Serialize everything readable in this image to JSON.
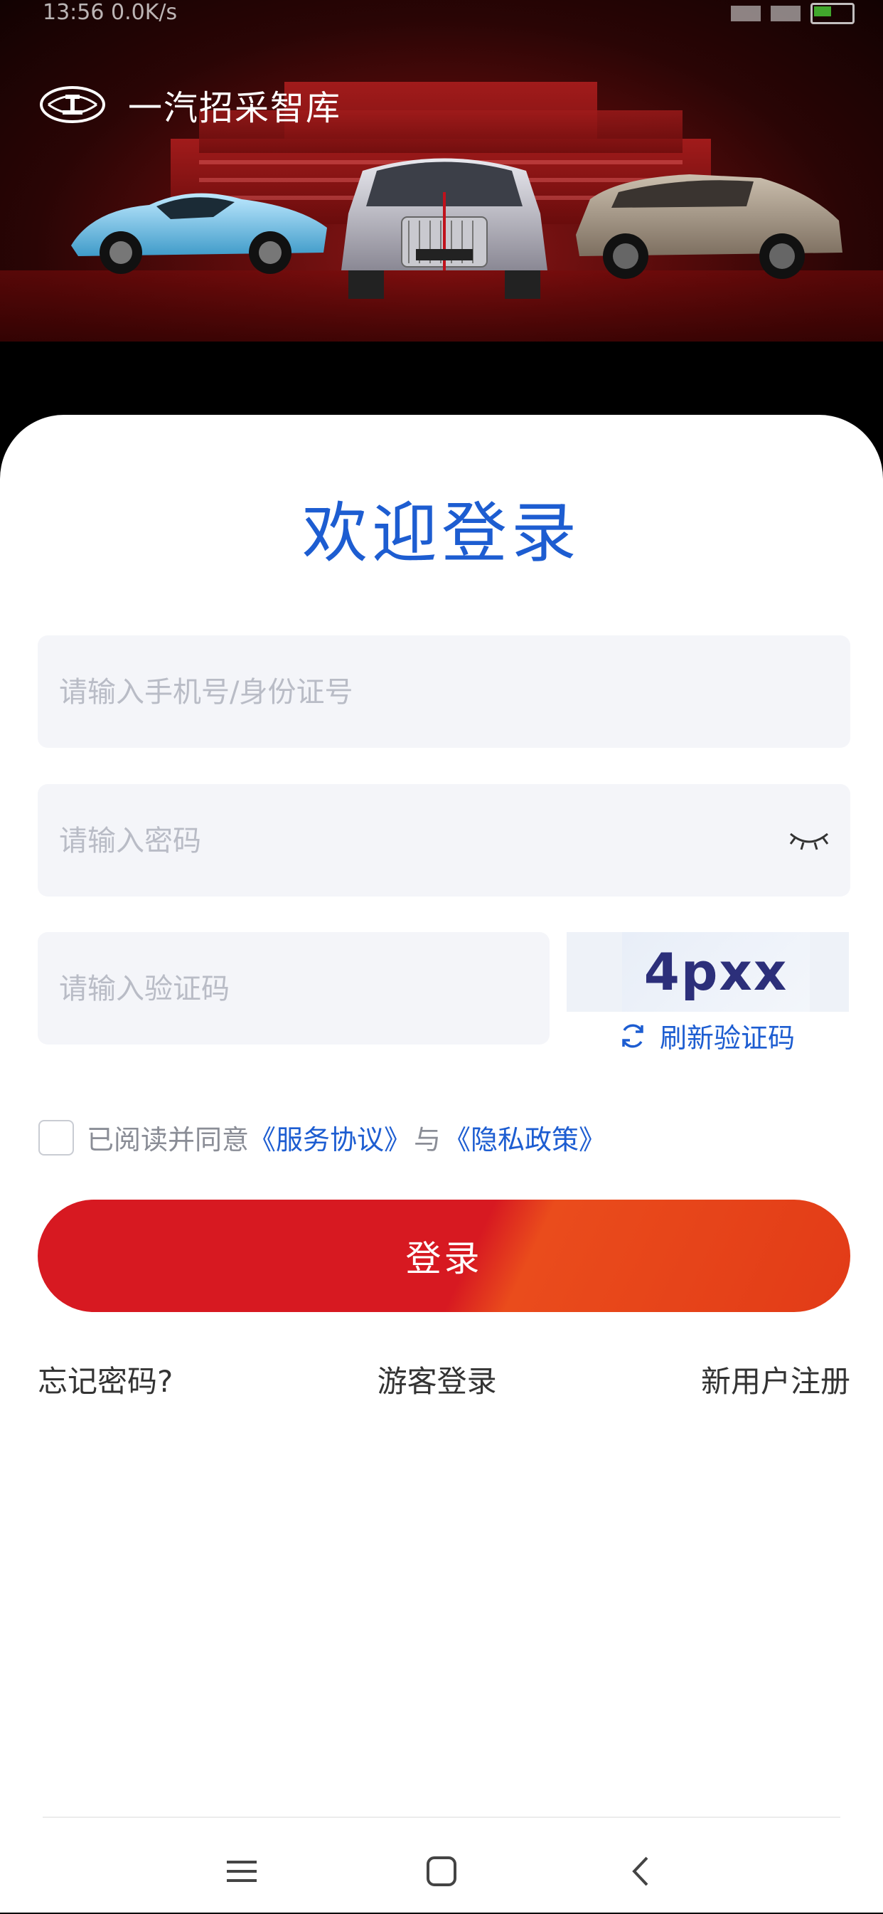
{
  "status": {
    "time": "13:56 0.0K/s"
  },
  "brand": {
    "name": "一汽招采智库"
  },
  "login": {
    "title": "欢迎登录",
    "phone_placeholder": "请输入手机号/身份证号",
    "password_placeholder": "请输入密码",
    "captcha_placeholder": "请输入验证码",
    "captcha_code": "4pxx",
    "refresh_label": "刷新验证码",
    "agree_prefix": "已阅读并同意",
    "service_link": "《服务协议》",
    "agree_join": "与",
    "privacy_link": "《隐私政策》",
    "login_button": "登录",
    "forgot_password": "忘记密码?",
    "guest_login": "游客登录",
    "register": "新用户注册"
  },
  "icons": {
    "eye": "eye-closed-icon",
    "refresh": "refresh-icon",
    "menu": "menu-icon",
    "home": "home-icon",
    "back": "back-icon"
  },
  "colors": {
    "accent_blue": "#1d5dd1",
    "brand_red": "#d71921",
    "field_bg": "#f4f5f9"
  }
}
